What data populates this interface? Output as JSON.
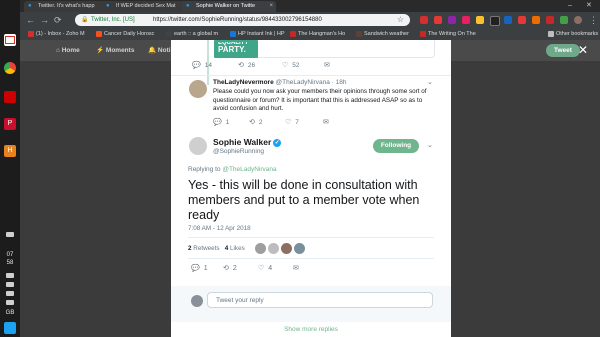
{
  "browser": {
    "tabs": [
      {
        "label": "Twitter. It's what's happ",
        "active": false
      },
      {
        "label": "If WEP decided Sex Mat",
        "active": false
      },
      {
        "label": "Sophie Walker on Twitte",
        "active": true
      }
    ],
    "address": {
      "origin": "Twitter, Inc. [US]",
      "url": "https://twitter.com/SophieRunning/status/984433002796154880"
    },
    "bookmarks": [
      "(1) - Inbox - Zoho M",
      "Cancer Daily Horosc",
      "earth :: a global m",
      "HP Instant Ink | HP",
      "The Hangman's Ho",
      "Sandwich weather",
      "The Writing On The",
      "Other bookmarks"
    ]
  },
  "shelf": {
    "clock_hour": "07",
    "clock_minute": "58",
    "locale": "GB"
  },
  "twitter_nav": {
    "home": "Home",
    "moments": "Moments",
    "notifications": "Noti",
    "tweet_button": "Tweet"
  },
  "top_card": {
    "text_line1": "EQUALITY",
    "text_line2": "PARTY.",
    "reply_count": "14",
    "retweet_count": "26",
    "like_count": "52"
  },
  "reply_tweet": {
    "name": "TheLadyNevermore",
    "handle": "@TheLadyNirvana",
    "time": "· 18h",
    "text": "Please could you now ask your members their opinions through some sort of questionnaire or forum? It is important that this is addressed ASAP so as to avoid confusion and hurt.",
    "reply_count": "1",
    "retweet_count": "2",
    "like_count": "7"
  },
  "main_tweet": {
    "name": "Sophie Walker",
    "handle": "@SophieRunning",
    "follow_label": "Following",
    "replying_prefix": "Replying to",
    "replying_to": "@TheLadyNirvana",
    "text": "Yes - this will be done in consultation with members and put to a member vote when ready",
    "timestamp": "7:08 AM - 12 Apr 2018",
    "retweets_count": "2",
    "retweets_label": "Retweets",
    "likes_count": "4",
    "likes_label": "Likes",
    "reply_count": "1",
    "retweet_count": "2",
    "like_count": "4"
  },
  "reply_box": {
    "placeholder": "Tweet your reply"
  },
  "show_more": "Show more replies",
  "colors": {
    "twitter_green": "#6fb58d",
    "equality_teal": "#3fa68a",
    "verified_blue": "#1da1f2"
  }
}
